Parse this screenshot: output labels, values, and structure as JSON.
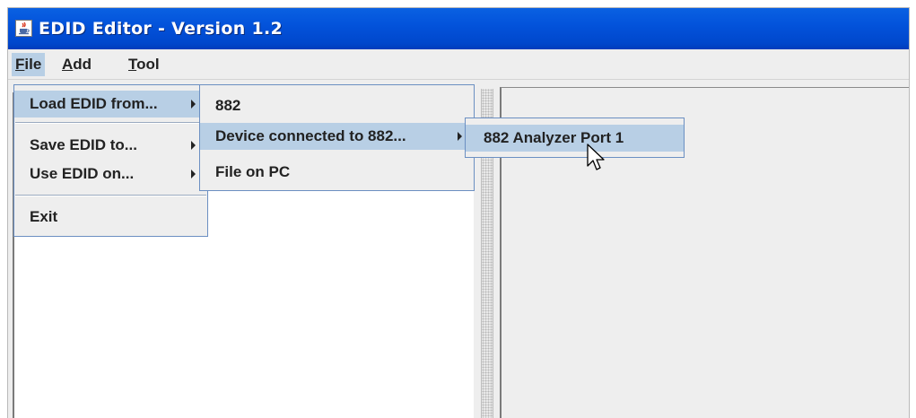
{
  "window": {
    "title": "EDID Editor - Version 1.2"
  },
  "menubar": {
    "file": {
      "prefix": "",
      "mnemonic": "F",
      "rest": "ile"
    },
    "add": {
      "prefix": "",
      "mnemonic": "A",
      "rest": "dd"
    },
    "tool": {
      "prefix": "",
      "mnemonic": "T",
      "rest": "ool"
    }
  },
  "file_menu": {
    "items": [
      {
        "label": "Load EDID from...",
        "has_submenu": true,
        "selected": true
      },
      {
        "label": "Save EDID to...",
        "has_submenu": true
      },
      {
        "label": "Use EDID on...",
        "has_submenu": true
      },
      {
        "label": "Exit"
      }
    ]
  },
  "load_submenu": {
    "items": [
      {
        "label": "882"
      },
      {
        "label": "Device connected to 882...",
        "has_submenu": true,
        "selected": true
      },
      {
        "label": "File on PC"
      }
    ]
  },
  "device_submenu": {
    "items": [
      {
        "label": "882 Analyzer Port 1",
        "selected": true
      }
    ]
  },
  "icons": {
    "app": "java-cup-icon",
    "cursor": "mouse-pointer-icon"
  },
  "colors": {
    "titlebar": "#0353db",
    "menu_selection": "#b8cfe5",
    "menu_background": "#eeeeee"
  }
}
